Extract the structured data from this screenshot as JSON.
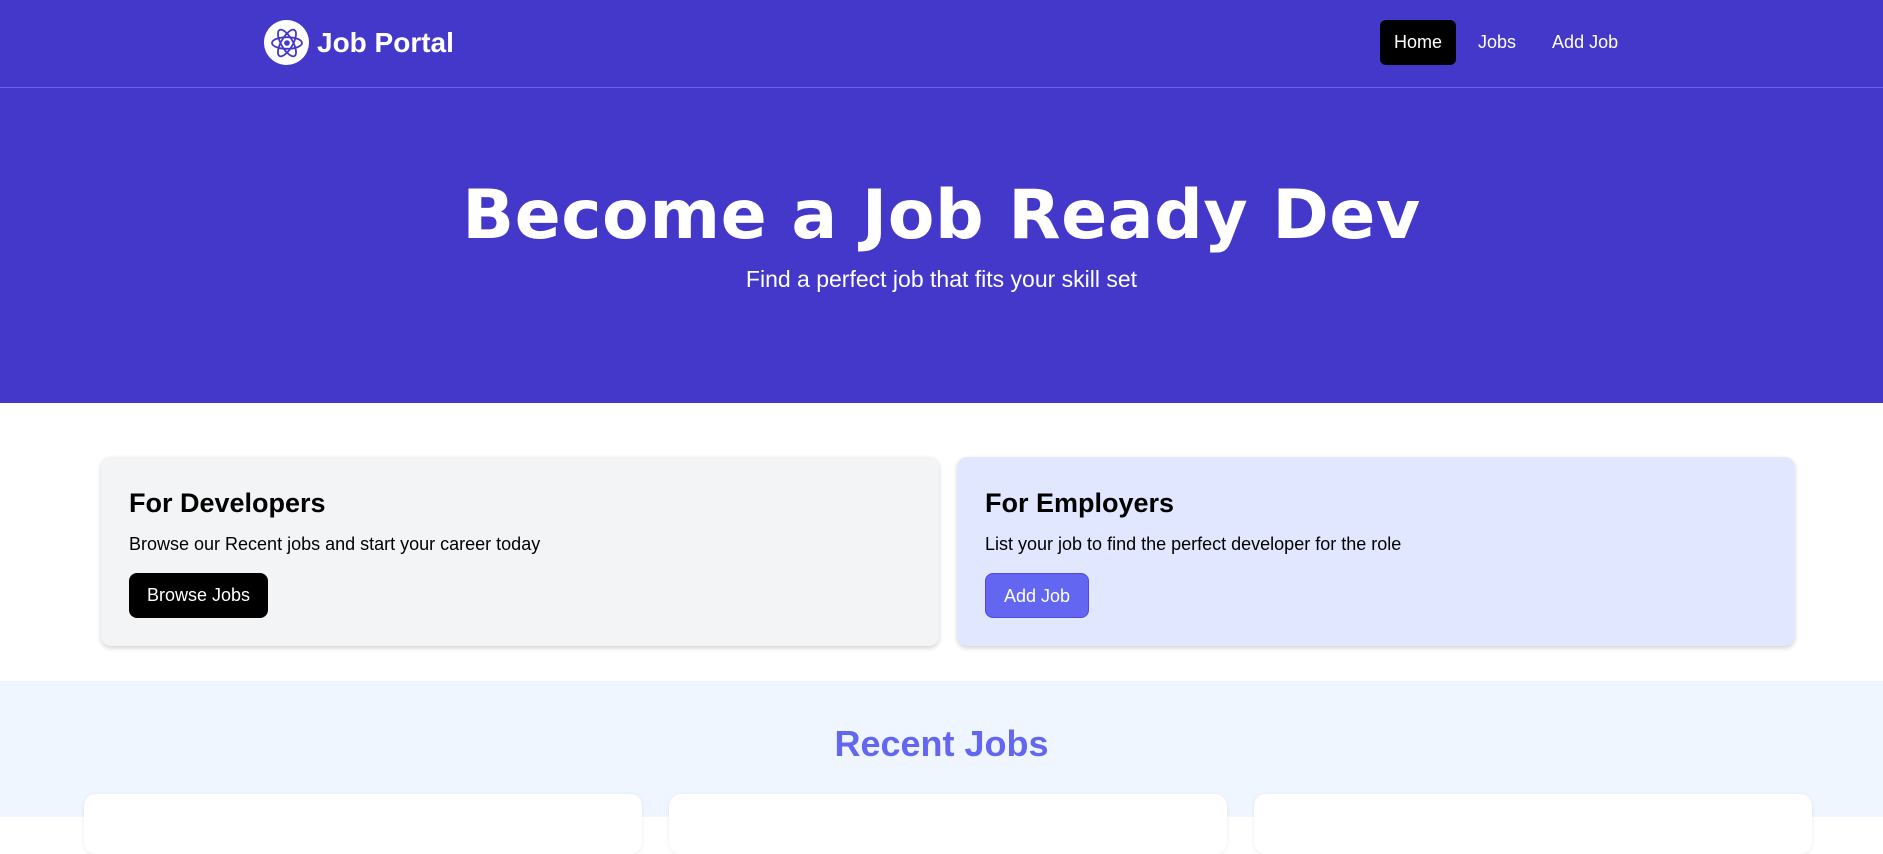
{
  "navbar": {
    "brand": {
      "title": "Job Portal",
      "logo_icon": "react-atom-icon"
    },
    "links": [
      {
        "label": "Home",
        "active": true
      },
      {
        "label": "Jobs",
        "active": false
      },
      {
        "label": "Add Job",
        "active": false
      }
    ]
  },
  "hero": {
    "title": "Become a Job Ready Dev",
    "subtitle": "Find a perfect job that fits your skill set"
  },
  "cards": {
    "developers": {
      "title": "For Developers",
      "text": "Browse our Recent jobs and start your career today",
      "button_label": "Browse Jobs"
    },
    "employers": {
      "title": "For Employers",
      "text": "List your job to find the perfect developer for the role",
      "button_label": "Add Job"
    }
  },
  "recent_jobs": {
    "title": "Recent Jobs"
  },
  "colors": {
    "primary": "#4338ca",
    "accent": "#6366f1",
    "dev_card_bg": "#f3f4f6",
    "employer_card_bg": "#e0e7ff",
    "recent_bg": "#eff6ff"
  }
}
